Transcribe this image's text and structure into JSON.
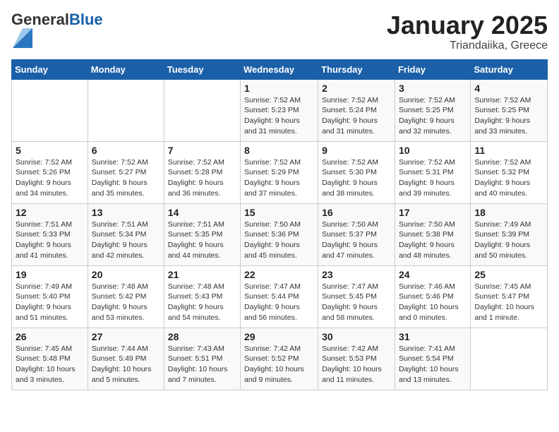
{
  "logo": {
    "general": "General",
    "blue": "Blue"
  },
  "header": {
    "month": "January 2025",
    "location": "Triandaiika, Greece"
  },
  "weekdays": [
    "Sunday",
    "Monday",
    "Tuesday",
    "Wednesday",
    "Thursday",
    "Friday",
    "Saturday"
  ],
  "weeks": [
    [
      null,
      null,
      null,
      {
        "day": "1",
        "sunrise": "7:52 AM",
        "sunset": "5:23 PM",
        "daylight": "9 hours and 31 minutes."
      },
      {
        "day": "2",
        "sunrise": "7:52 AM",
        "sunset": "5:24 PM",
        "daylight": "9 hours and 31 minutes."
      },
      {
        "day": "3",
        "sunrise": "7:52 AM",
        "sunset": "5:25 PM",
        "daylight": "9 hours and 32 minutes."
      },
      {
        "day": "4",
        "sunrise": "7:52 AM",
        "sunset": "5:25 PM",
        "daylight": "9 hours and 33 minutes."
      }
    ],
    [
      {
        "day": "5",
        "sunrise": "7:52 AM",
        "sunset": "5:26 PM",
        "daylight": "9 hours and 34 minutes."
      },
      {
        "day": "6",
        "sunrise": "7:52 AM",
        "sunset": "5:27 PM",
        "daylight": "9 hours and 35 minutes."
      },
      {
        "day": "7",
        "sunrise": "7:52 AM",
        "sunset": "5:28 PM",
        "daylight": "9 hours and 36 minutes."
      },
      {
        "day": "8",
        "sunrise": "7:52 AM",
        "sunset": "5:29 PM",
        "daylight": "9 hours and 37 minutes."
      },
      {
        "day": "9",
        "sunrise": "7:52 AM",
        "sunset": "5:30 PM",
        "daylight": "9 hours and 38 minutes."
      },
      {
        "day": "10",
        "sunrise": "7:52 AM",
        "sunset": "5:31 PM",
        "daylight": "9 hours and 39 minutes."
      },
      {
        "day": "11",
        "sunrise": "7:52 AM",
        "sunset": "5:32 PM",
        "daylight": "9 hours and 40 minutes."
      }
    ],
    [
      {
        "day": "12",
        "sunrise": "7:51 AM",
        "sunset": "5:33 PM",
        "daylight": "9 hours and 41 minutes."
      },
      {
        "day": "13",
        "sunrise": "7:51 AM",
        "sunset": "5:34 PM",
        "daylight": "9 hours and 42 minutes."
      },
      {
        "day": "14",
        "sunrise": "7:51 AM",
        "sunset": "5:35 PM",
        "daylight": "9 hours and 44 minutes."
      },
      {
        "day": "15",
        "sunrise": "7:50 AM",
        "sunset": "5:36 PM",
        "daylight": "9 hours and 45 minutes."
      },
      {
        "day": "16",
        "sunrise": "7:50 AM",
        "sunset": "5:37 PM",
        "daylight": "9 hours and 47 minutes."
      },
      {
        "day": "17",
        "sunrise": "7:50 AM",
        "sunset": "5:38 PM",
        "daylight": "9 hours and 48 minutes."
      },
      {
        "day": "18",
        "sunrise": "7:49 AM",
        "sunset": "5:39 PM",
        "daylight": "9 hours and 50 minutes."
      }
    ],
    [
      {
        "day": "19",
        "sunrise": "7:49 AM",
        "sunset": "5:40 PM",
        "daylight": "9 hours and 51 minutes."
      },
      {
        "day": "20",
        "sunrise": "7:48 AM",
        "sunset": "5:42 PM",
        "daylight": "9 hours and 53 minutes."
      },
      {
        "day": "21",
        "sunrise": "7:48 AM",
        "sunset": "5:43 PM",
        "daylight": "9 hours and 54 minutes."
      },
      {
        "day": "22",
        "sunrise": "7:47 AM",
        "sunset": "5:44 PM",
        "daylight": "9 hours and 56 minutes."
      },
      {
        "day": "23",
        "sunrise": "7:47 AM",
        "sunset": "5:45 PM",
        "daylight": "9 hours and 58 minutes."
      },
      {
        "day": "24",
        "sunrise": "7:46 AM",
        "sunset": "5:46 PM",
        "daylight": "10 hours and 0 minutes."
      },
      {
        "day": "25",
        "sunrise": "7:45 AM",
        "sunset": "5:47 PM",
        "daylight": "10 hours and 1 minute."
      }
    ],
    [
      {
        "day": "26",
        "sunrise": "7:45 AM",
        "sunset": "5:48 PM",
        "daylight": "10 hours and 3 minutes."
      },
      {
        "day": "27",
        "sunrise": "7:44 AM",
        "sunset": "5:49 PM",
        "daylight": "10 hours and 5 minutes."
      },
      {
        "day": "28",
        "sunrise": "7:43 AM",
        "sunset": "5:51 PM",
        "daylight": "10 hours and 7 minutes."
      },
      {
        "day": "29",
        "sunrise": "7:42 AM",
        "sunset": "5:52 PM",
        "daylight": "10 hours and 9 minutes."
      },
      {
        "day": "30",
        "sunrise": "7:42 AM",
        "sunset": "5:53 PM",
        "daylight": "10 hours and 11 minutes."
      },
      {
        "day": "31",
        "sunrise": "7:41 AM",
        "sunset": "5:54 PM",
        "daylight": "10 hours and 13 minutes."
      },
      null
    ]
  ]
}
